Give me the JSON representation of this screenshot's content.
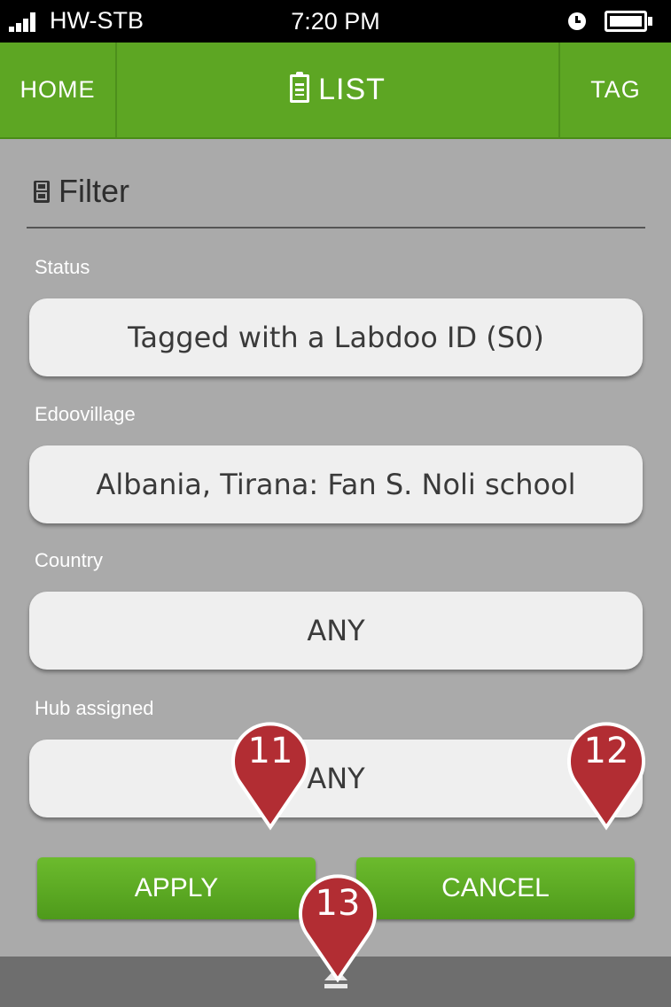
{
  "status_bar": {
    "carrier": "HW-STB",
    "time": "7:20 PM"
  },
  "nav": {
    "home": "HOME",
    "title": "LIST",
    "tag": "TAG"
  },
  "filter": {
    "heading": "Filter",
    "fields": [
      {
        "label": "Status",
        "value": "Tagged with a Labdoo ID (S0)"
      },
      {
        "label": "Edoovillage",
        "value": "Albania, Tirana: Fan S. Noli school"
      },
      {
        "label": "Country",
        "value": "ANY"
      },
      {
        "label": "Hub assigned",
        "value": "ANY"
      }
    ]
  },
  "actions": {
    "apply": "APPLY",
    "cancel": "CANCEL"
  },
  "markers": [
    "11",
    "12",
    "13"
  ],
  "colors": {
    "nav_green": "#5da623",
    "button_green": "#5aa824",
    "marker_red": "#b22d33",
    "background": "#aaaaaa"
  }
}
